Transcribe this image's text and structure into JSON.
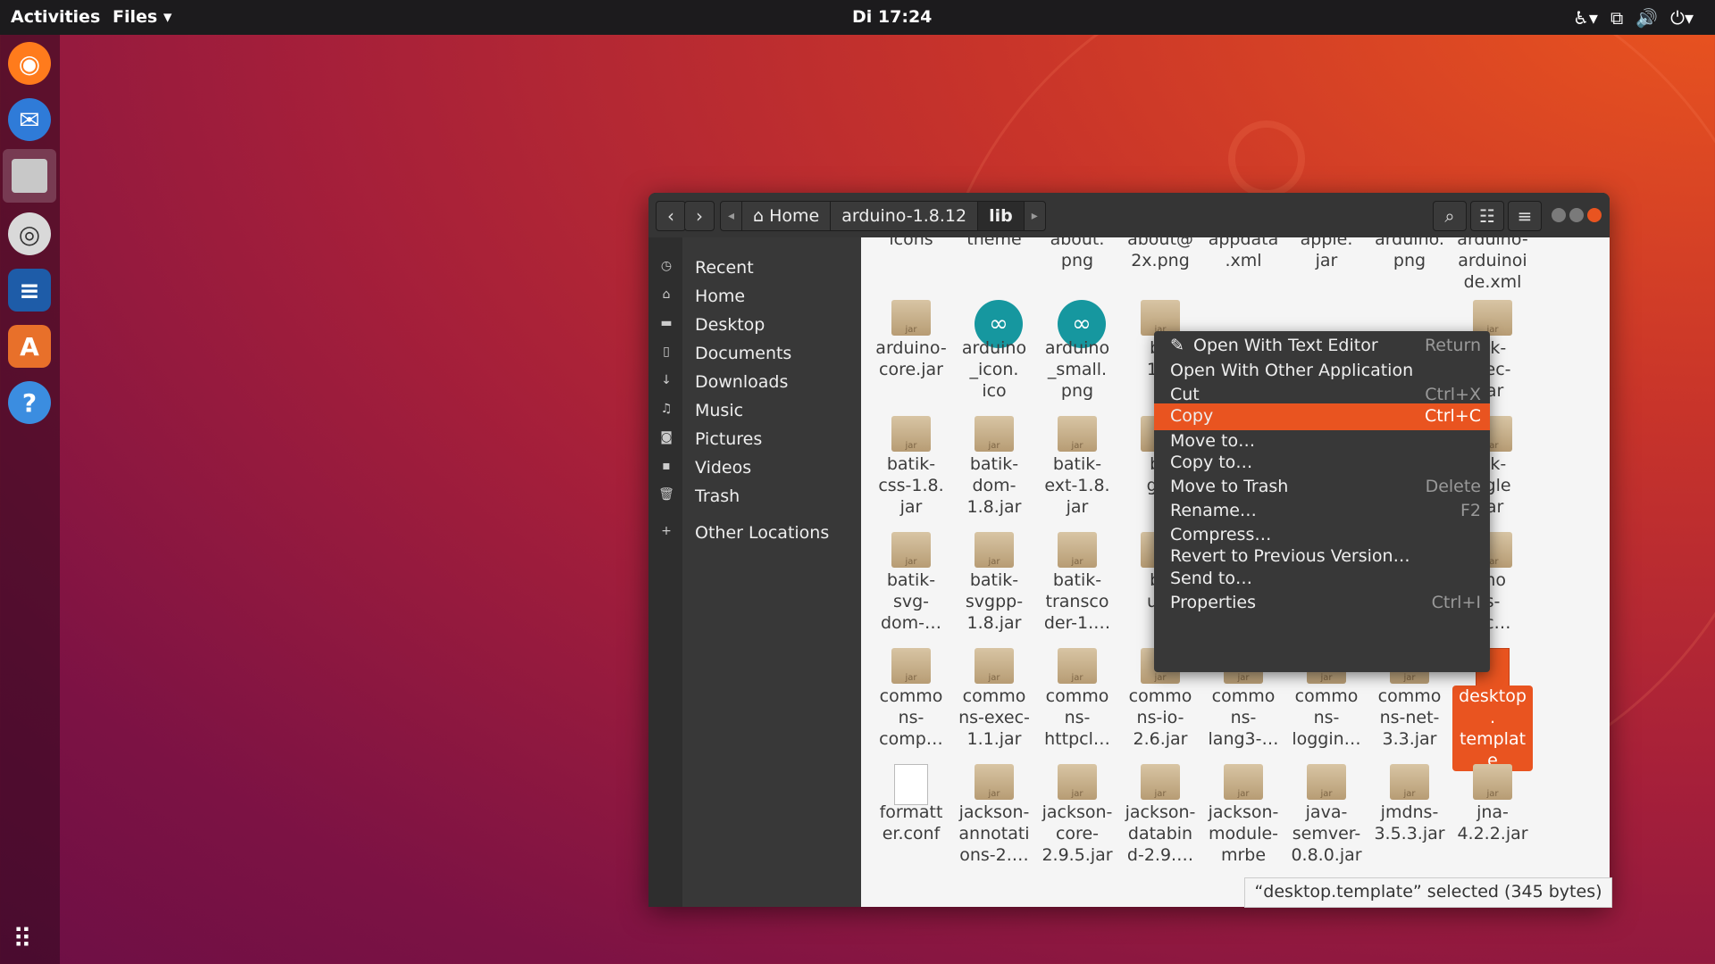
{
  "topbar": {
    "activities": "Activities",
    "app_menu": "Files",
    "clock": "Di 17:24"
  },
  "window": {
    "breadcrumbs": [
      "Home",
      "arduino-1.8.12",
      "lib"
    ],
    "sidebar": [
      "Recent",
      "Home",
      "Desktop",
      "Documents",
      "Downloads",
      "Music",
      "Pictures",
      "Videos",
      "Trash",
      "Other Locations"
    ]
  },
  "files": {
    "row0": [
      "icons",
      "theme",
      "about.\npng",
      "about@\n2x.png",
      "appdata\n.xml",
      "apple.\njar",
      "arduino.\npng",
      "arduino-\narduinoi\nde.xml"
    ],
    "row1": [
      "arduino-\ncore.jar",
      "arduino\n_icon.\nico",
      "arduino\n_small.\npng",
      "ba\n1.8",
      "",
      "",
      "",
      "tik-\ndec-\njar"
    ],
    "row2": [
      "batik-\ncss-1.8.\njar",
      "batik-\ndom-\n1.8.jar",
      "batik-\next-1.8.\njar",
      "ba\ngvt\nj",
      "",
      "",
      "",
      "tik-\nggle\njar"
    ],
    "row3": [
      "batik-\nsvg-\ndom-…",
      "batik-\nsvgpp-\n1.8.jar",
      "batik-\ntransco\nder-1.…",
      "ba\nutil\nj",
      "",
      "",
      "",
      "mo\ns-\nec…"
    ],
    "row4": [
      "commo\nns-\ncomp…",
      "commo\nns-exec-\n1.1.jar",
      "commo\nns-\nhttpcl…",
      "commo\nns-io-\n2.6.jar",
      "commo\nns-\nlang3-…",
      "commo\nns-\nloggin…",
      "commo\nns-net-\n3.3.jar",
      "desktop\n.\ntemplat\ne"
    ],
    "row5": [
      "formatt\ner.conf",
      "jackson-\nannotati\nons-2.…",
      "jackson-\ncore-\n2.9.5.jar",
      "jackson-\ndatabin\nd-2.9.…",
      "jackson-\nmodule-\nmrbe",
      "java-\nsemver-\n0.8.0.jar",
      "jmdns-\n3.5.3.jar",
      "jna-\n4.2.2.jar"
    ]
  },
  "context_menu": [
    {
      "label": "Open With Text Editor",
      "shortcut": "Return"
    },
    {
      "label": "Open With Other Application",
      "shortcut": ""
    },
    {
      "label": "Cut",
      "shortcut": "Ctrl+X"
    },
    {
      "label": "Copy",
      "shortcut": "Ctrl+C"
    },
    {
      "label": "Move to…",
      "shortcut": ""
    },
    {
      "label": "Copy to…",
      "shortcut": ""
    },
    {
      "label": "Move to Trash",
      "shortcut": "Delete"
    },
    {
      "label": "Rename…",
      "shortcut": "F2"
    },
    {
      "label": "Compress…",
      "shortcut": ""
    },
    {
      "label": "Revert to Previous Version…",
      "shortcut": ""
    },
    {
      "label": "Send to…",
      "shortcut": ""
    },
    {
      "label": "Properties",
      "shortcut": "Ctrl+I"
    }
  ],
  "status": "“desktop.template” selected (345 bytes)",
  "colors": {
    "accent": "#e95420"
  }
}
